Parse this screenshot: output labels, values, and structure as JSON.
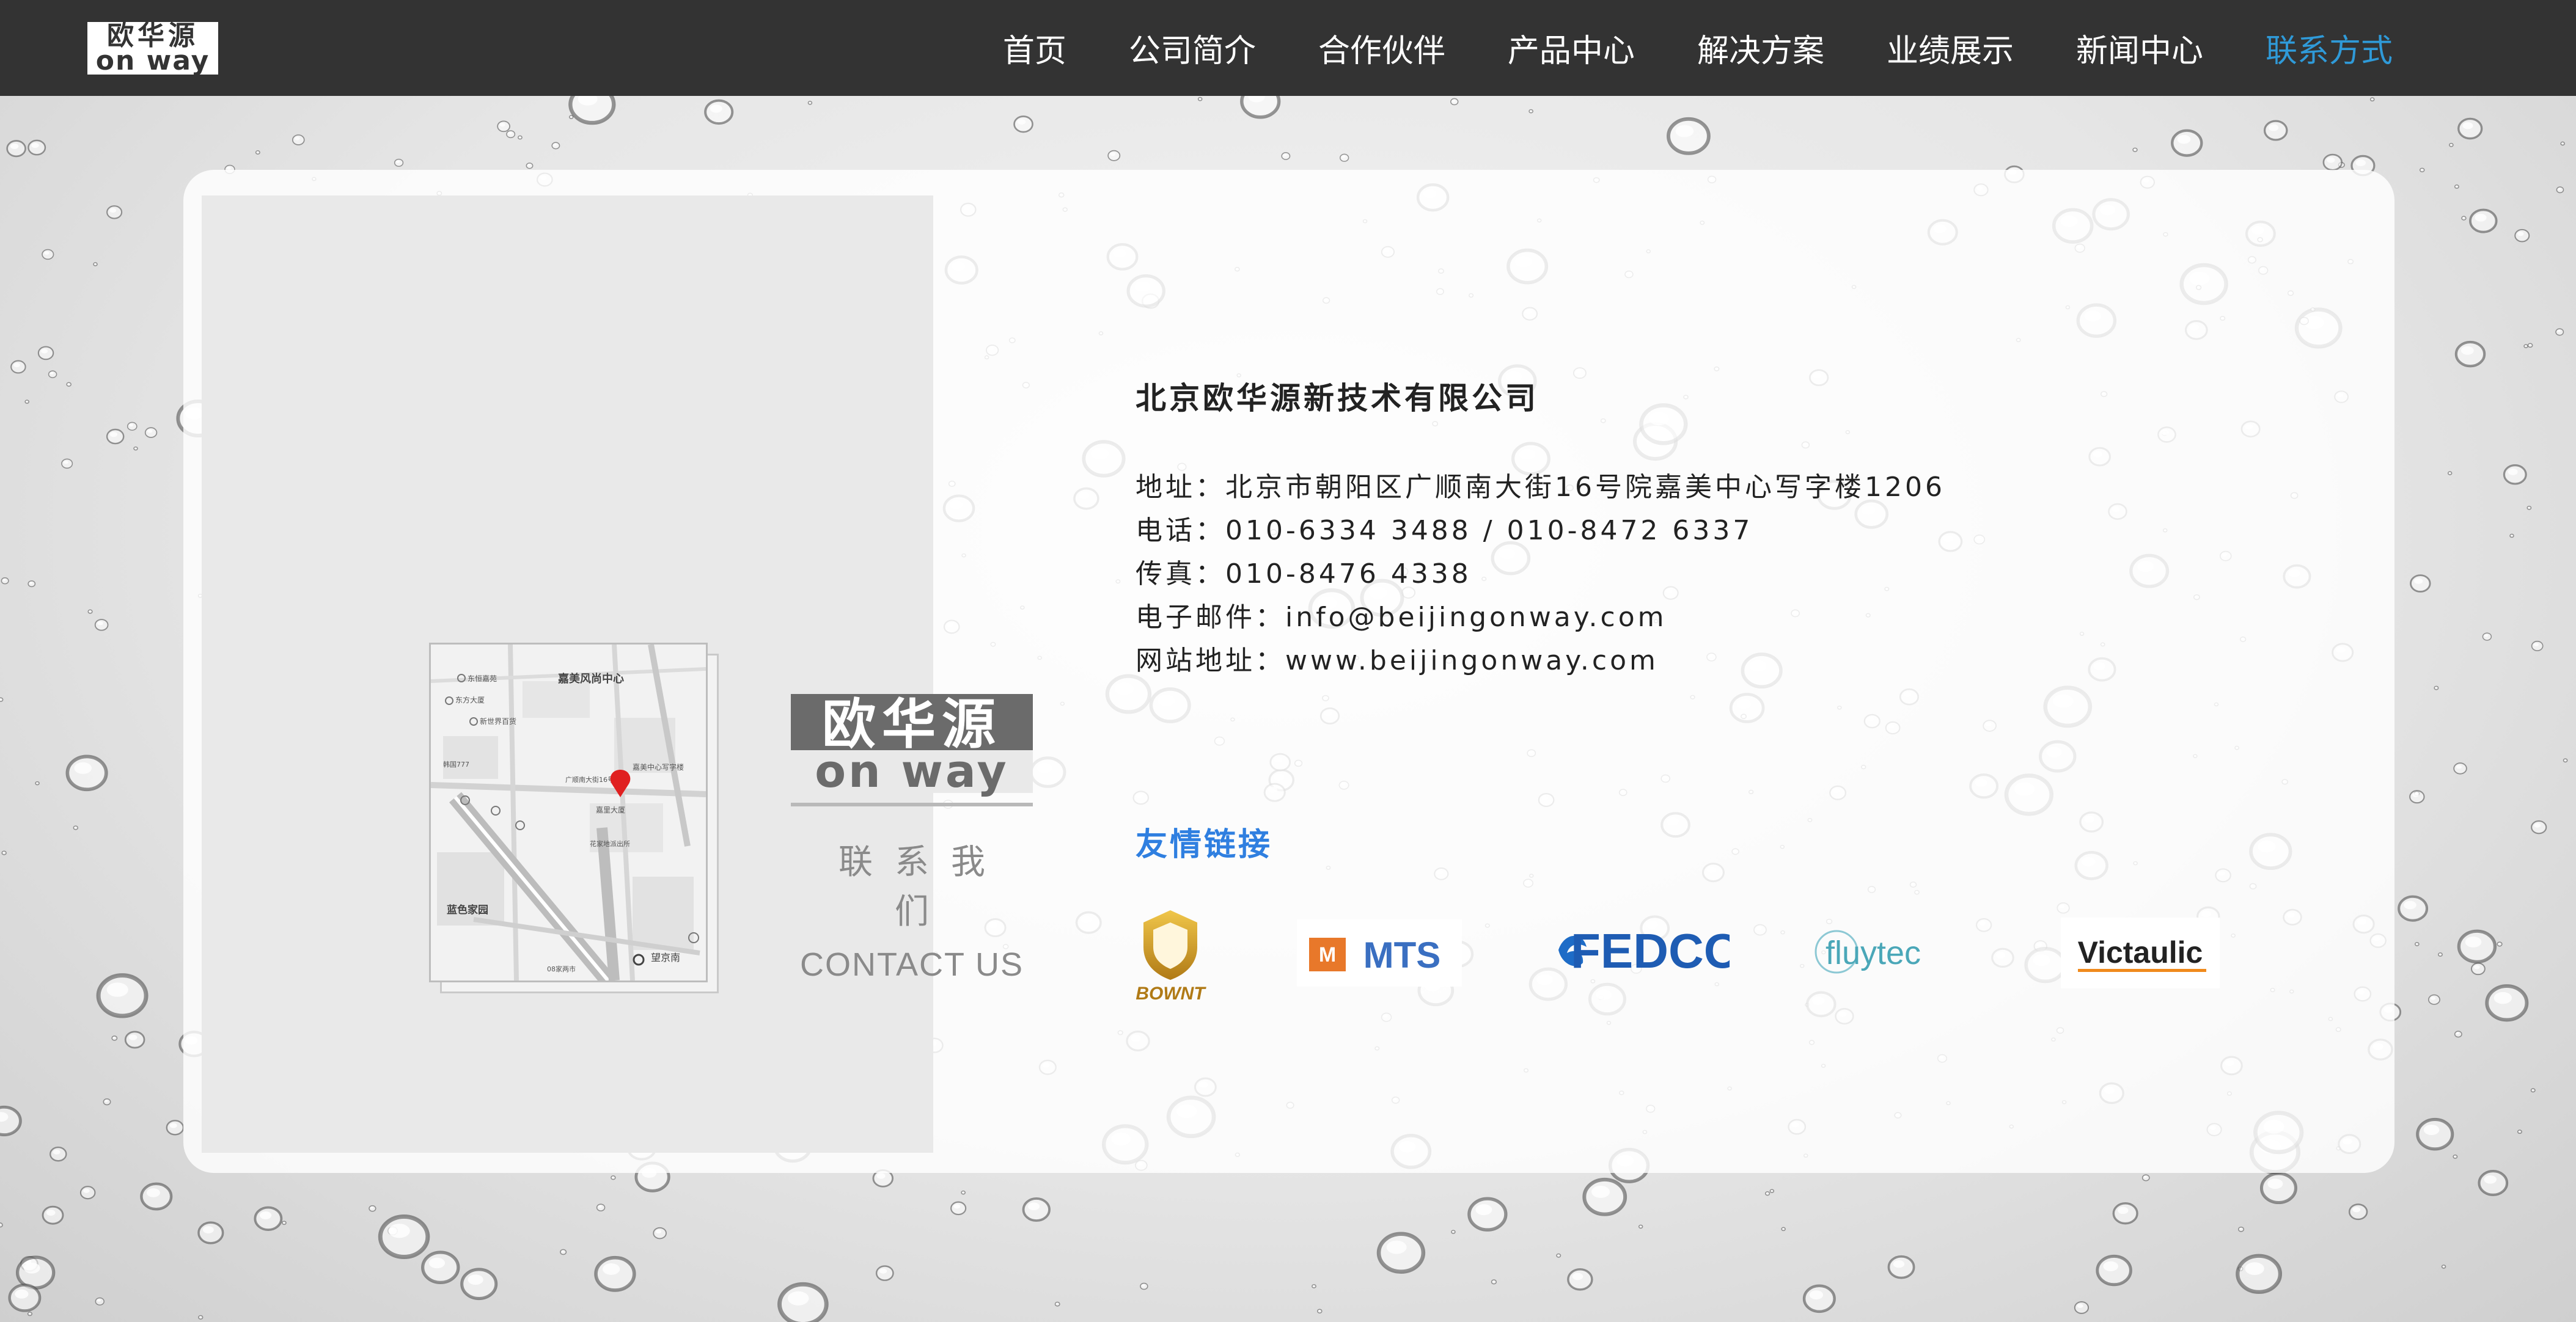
{
  "nav": {
    "logo": {
      "cn": "欧华源",
      "en": "on way"
    },
    "items": [
      {
        "label": "首页",
        "active": false
      },
      {
        "label": "公司简介",
        "active": false
      },
      {
        "label": "合作伙伴",
        "active": false
      },
      {
        "label": "产品中心",
        "active": false
      },
      {
        "label": "解决方案",
        "active": false
      },
      {
        "label": "业绩展示",
        "active": false
      },
      {
        "label": "新闻中心",
        "active": false
      },
      {
        "label": "联系方式",
        "active": true
      }
    ],
    "active_color": "#2f9ad8"
  },
  "brand": {
    "logo_cn": "欧华源",
    "logo_en": "on way",
    "contact_cn": "联系我们",
    "contact_en": "CONTACT US"
  },
  "map": {
    "labels": {
      "area1": "嘉美风尚中心",
      "area2": "蓝色家园",
      "station": "望京南",
      "poi1": "东恒嘉苑",
      "poi2": "东方大厦",
      "poi3": "新世界百货",
      "poi4": "嘉美中心写字楼",
      "poi5": "广顺南大街16号",
      "poi6": "韩国777",
      "poi7": "嘉里大厦",
      "poi8": "花家地派出所",
      "poi9": "08家两市"
    },
    "marker_color": "#e02020"
  },
  "company": {
    "name": "北京欧华源新技术有限公司",
    "address": "地址：北京市朝阳区广顺南大街16号院嘉美中心写字楼1206",
    "phone": "电话：010-6334 3488 / 010-8472 6337",
    "fax": "传真：010-8476 4338",
    "email": "电子邮件：info@beijingonway.com",
    "website": "网站地址：www.beijingonway.com"
  },
  "links": {
    "title": "友情链接",
    "partners": [
      {
        "name": "BOWNT",
        "icon": "bownt-shield-logo"
      },
      {
        "name": "MTS",
        "icon": "mts-logo"
      },
      {
        "name": "FEDCO",
        "icon": "fedco-logo"
      },
      {
        "name": "fluytec",
        "icon": "fluytec-logo"
      },
      {
        "name": "Victaulic",
        "icon": "victaulic-logo"
      }
    ],
    "title_color": "#2f7fe0"
  }
}
